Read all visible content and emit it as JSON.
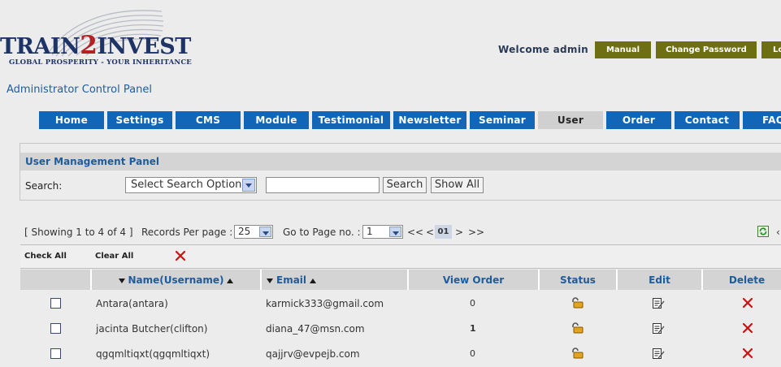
{
  "header": {
    "brand_pre": "TRAIN",
    "brand_two": "2",
    "brand_post": "INVEST",
    "tagline": "GLOBAL PROSPERITY - YOUR INHERITANCE",
    "panel_title": "Administrator Control Panel",
    "welcome": "Welcome admin",
    "buttons": [
      "Manual",
      "Change Password",
      "Lo"
    ]
  },
  "nav": {
    "items": [
      "Home",
      "Settings",
      "CMS",
      "Module",
      "Testimonial",
      "Newsletter",
      "Seminar",
      "User",
      "Order",
      "Contact",
      "FAQ"
    ],
    "active": "User"
  },
  "search": {
    "panel_title": "User Management Panel",
    "label": "Search:",
    "select_value": "Select Search Option",
    "input_value": "",
    "search_button": "Search",
    "show_all_button": "Show All"
  },
  "paging": {
    "showing": "[ Showing 1 to 4 of 4 ]",
    "records_label": "Records Per page :",
    "records_value": "25",
    "goto_label": "Go to Page no. :",
    "goto_value": "1",
    "first": "<<",
    "prev": "<",
    "current": "01",
    "next": ">",
    "last": ">>"
  },
  "table": {
    "check_all": "Check All",
    "clear_all": "Clear All",
    "columns": [
      "Name(Username)",
      "Email",
      "View Order",
      "Status",
      "Edit",
      "Delete"
    ],
    "rows": [
      {
        "name": "Antara(antara)",
        "email": "karmick333@gmail.com",
        "orders": "0"
      },
      {
        "name": "jacinta Butcher(clifton)",
        "email": "diana_47@msn.com",
        "orders": "1"
      },
      {
        "name": "qgqmltiqxt(qgqmltiqxt)",
        "email": "qajjrv@evpejb.com",
        "orders": "0"
      }
    ]
  },
  "colors": {
    "nav_blue": "#1166b8",
    "top_button_olive": "#6e6e13",
    "link_blue": "#1e5c9c",
    "delete_red": "#cc1111"
  },
  "icons": [
    "refresh-icon",
    "lock-status-icon",
    "edit-icon",
    "delete-icon",
    "remove-x-icon"
  ]
}
